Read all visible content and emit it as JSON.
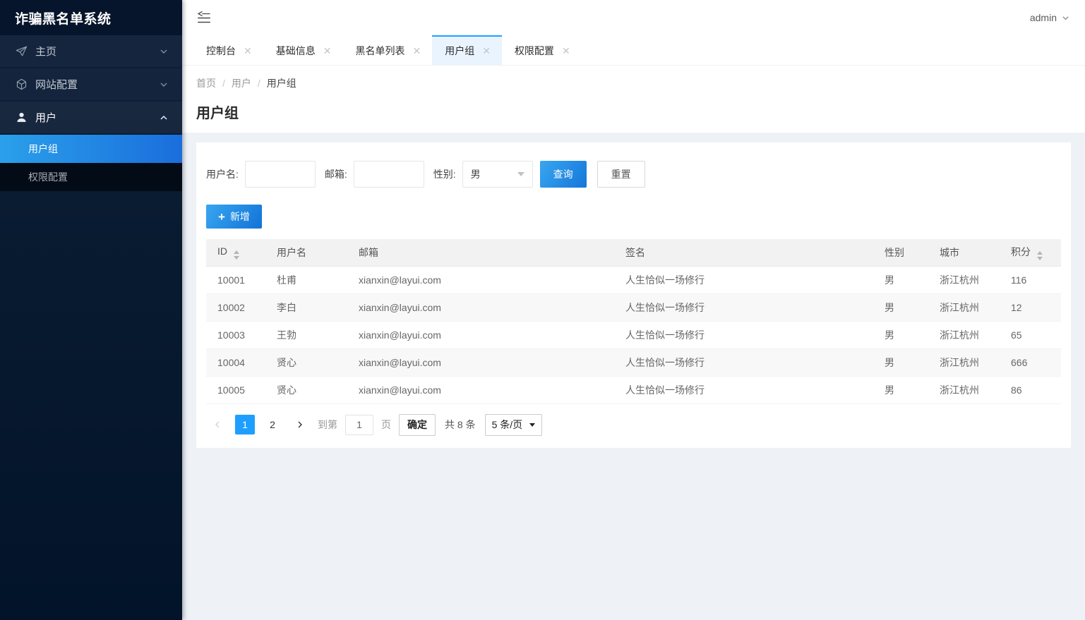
{
  "colors": {
    "accent_blue": "#1e9fff",
    "button_gradient": [
      "#38a6f0",
      "#1576da"
    ],
    "sidebar_active_gradient": [
      "#2aa0ea",
      "#1a6edc"
    ],
    "sidebar_bg_top": "#0e1f38",
    "sidebar_bg_bottom": "#02132a",
    "submenu_bg": "#030b16",
    "active_tab_bg": "#eaf4fe",
    "page_bg": "#eef1f5",
    "table_header_bg": "#f2f2f2",
    "table_stripe_bg": "#f8f8f8"
  },
  "sidebar": {
    "title": "诈骗黑名单系统",
    "items": [
      {
        "label": "主页",
        "icon": "send-icon",
        "chevron": "chevron-down-icon"
      },
      {
        "label": "网站配置",
        "icon": "cube-icon",
        "chevron": "chevron-down-icon"
      },
      {
        "label": "用户",
        "icon": "user-icon",
        "chevron": "chevron-up-icon",
        "expanded": true,
        "children": [
          {
            "label": "用户组",
            "active": true
          },
          {
            "label": "权限配置",
            "active": false
          }
        ]
      }
    ]
  },
  "header": {
    "fold_icon": "fold-menu-icon",
    "username": "admin",
    "user_chevron": "chevron-down-icon"
  },
  "tabs": [
    {
      "label": "控制台",
      "active": false
    },
    {
      "label": "基础信息",
      "active": false
    },
    {
      "label": "黑名单列表",
      "active": false
    },
    {
      "label": "用户组",
      "active": true
    },
    {
      "label": "权限配置",
      "active": false
    }
  ],
  "breadcrumb": {
    "items": [
      "首页",
      "用户",
      "用户组"
    ],
    "separator": "/"
  },
  "page": {
    "title": "用户组"
  },
  "filters": {
    "username": {
      "label": "用户名:",
      "value": "",
      "placeholder": ""
    },
    "email": {
      "label": "邮箱:",
      "value": "",
      "placeholder": ""
    },
    "gender": {
      "label": "性别:",
      "value": "男"
    },
    "search_button": "查询",
    "reset_button": "重置"
  },
  "toolbar": {
    "add_button": "新增",
    "plus": "+"
  },
  "table": {
    "columns": [
      {
        "label": "ID",
        "sortable": true
      },
      {
        "label": "用户名",
        "sortable": false
      },
      {
        "label": "邮箱",
        "sortable": false
      },
      {
        "label": "签名",
        "sortable": false
      },
      {
        "label": "性别",
        "sortable": false
      },
      {
        "label": "城市",
        "sortable": false
      },
      {
        "label": "积分",
        "sortable": true
      }
    ],
    "rows": [
      [
        "10001",
        "杜甫",
        "xianxin@layui.com",
        "人生恰似一场修行",
        "男",
        "浙江杭州",
        "116"
      ],
      [
        "10002",
        "李白",
        "xianxin@layui.com",
        "人生恰似一场修行",
        "男",
        "浙江杭州",
        "12"
      ],
      [
        "10003",
        "王勃",
        "xianxin@layui.com",
        "人生恰似一场修行",
        "男",
        "浙江杭州",
        "65"
      ],
      [
        "10004",
        "贤心",
        "xianxin@layui.com",
        "人生恰似一场修行",
        "男",
        "浙江杭州",
        "666"
      ],
      [
        "10005",
        "贤心",
        "xianxin@layui.com",
        "人生恰似一场修行",
        "男",
        "浙江杭州",
        "86"
      ]
    ]
  },
  "pagination": {
    "pages": [
      "1",
      "2"
    ],
    "active_page": "1",
    "goto_label": "到第",
    "goto_value": "1",
    "goto_unit": "页",
    "confirm_button": "确定",
    "total_label": "共 8 条",
    "page_size": "5 条/页"
  }
}
